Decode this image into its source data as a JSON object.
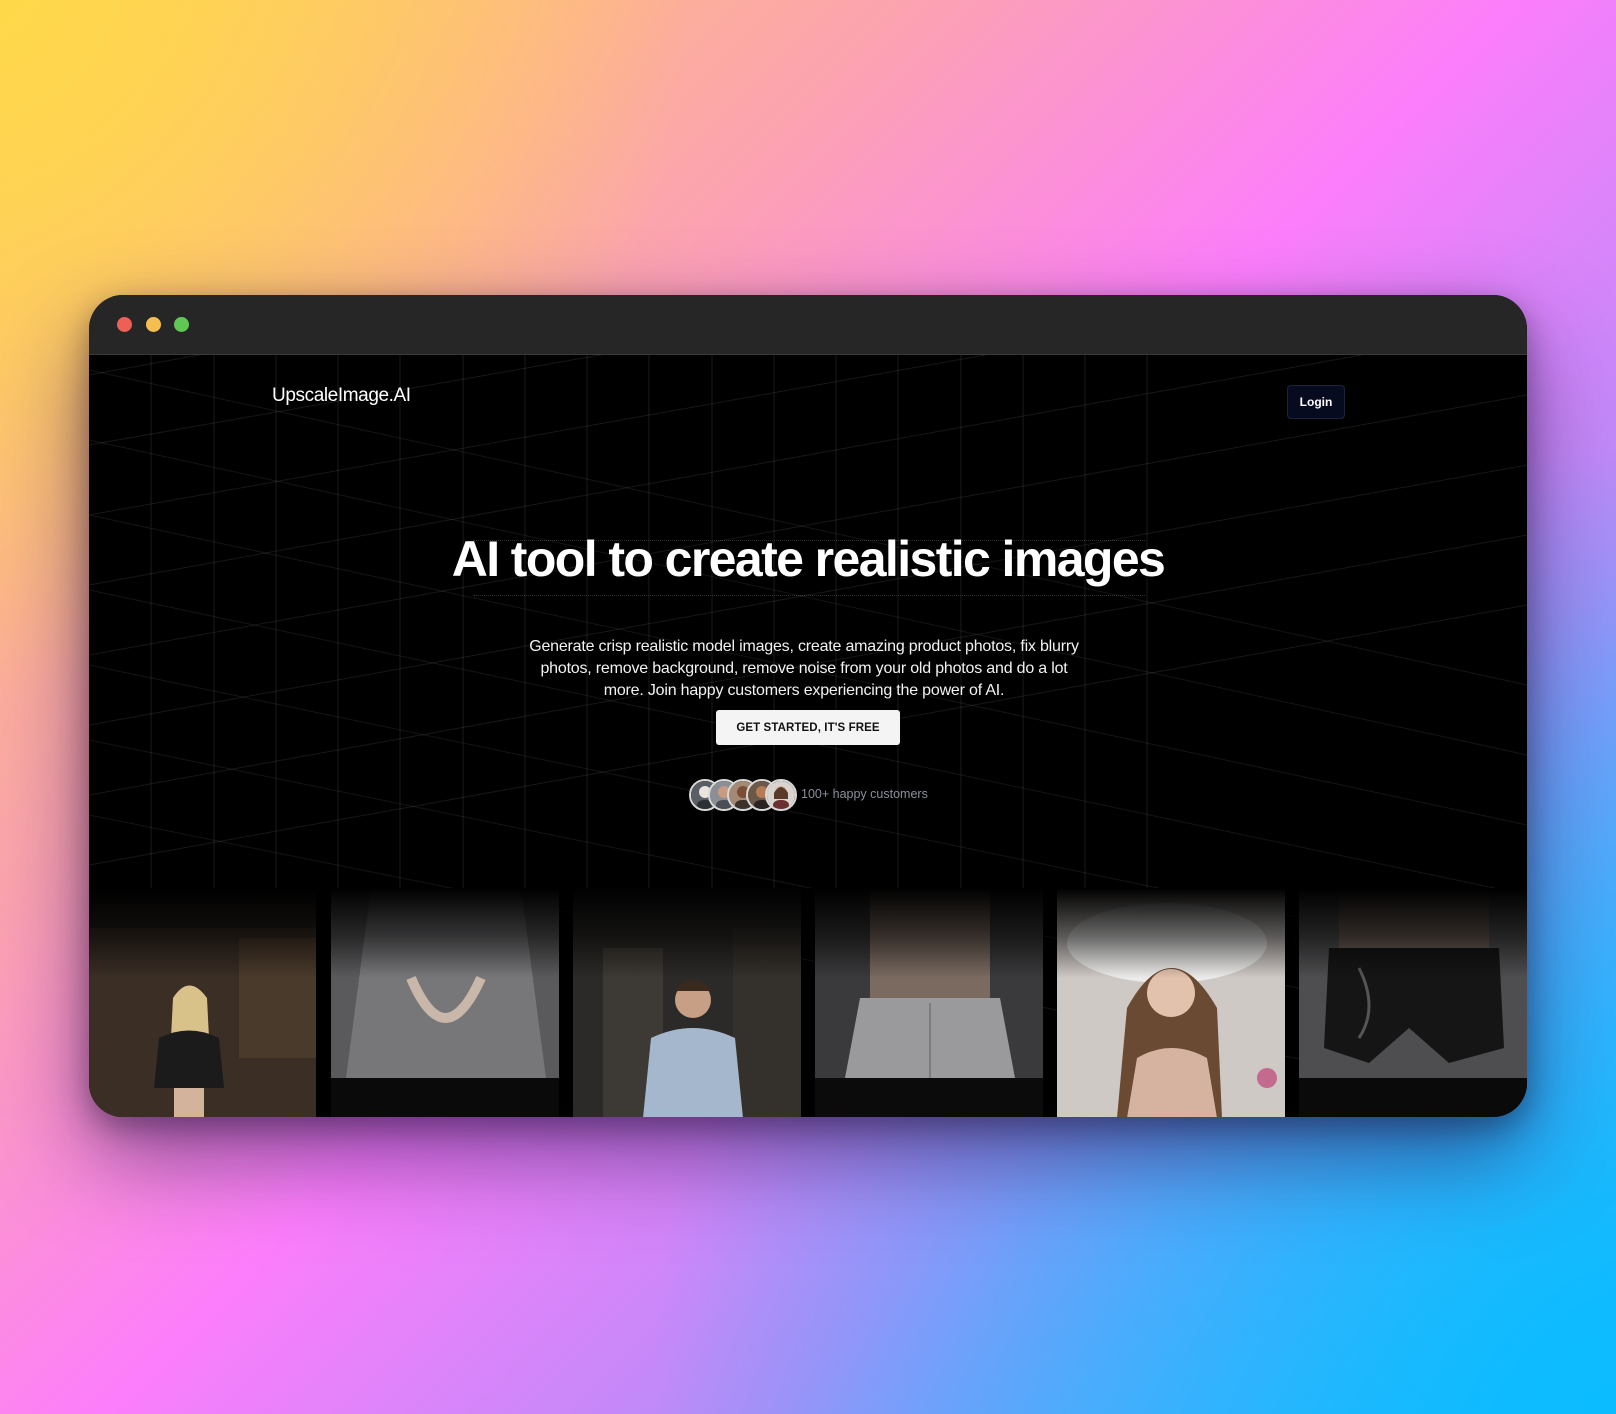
{
  "window": {
    "controls": [
      "close",
      "minimize",
      "maximize"
    ]
  },
  "nav": {
    "logo": "UpscaleImage.AI",
    "login_label": "Login"
  },
  "hero": {
    "title": "AI tool to create realistic images",
    "description": "Generate crisp realistic model images, create amazing product photos, fix blurry photos, remove background, remove noise from your old photos and do a lot more. Join happy customers experiencing the power of AI.",
    "cta_label": "GET STARTED, IT'S FREE",
    "customers_text": "100+ happy customers",
    "avatar_count": 5
  },
  "gallery": {
    "images": [
      {
        "subject": "woman in leather jacket at bar"
      },
      {
        "subject": "person in grey dress"
      },
      {
        "subject": "young man in light blue shirt"
      },
      {
        "subject": "man in grey sweatpants"
      },
      {
        "subject": "woman lying on white pillows"
      },
      {
        "subject": "person in black shiny shorts"
      }
    ]
  },
  "colors": {
    "page_bg": "#000000",
    "titlebar": "#262626",
    "cta_bg": "#f4f4f5",
    "login_bg": "#060b1f",
    "muted_text": "#8a8f9a"
  }
}
